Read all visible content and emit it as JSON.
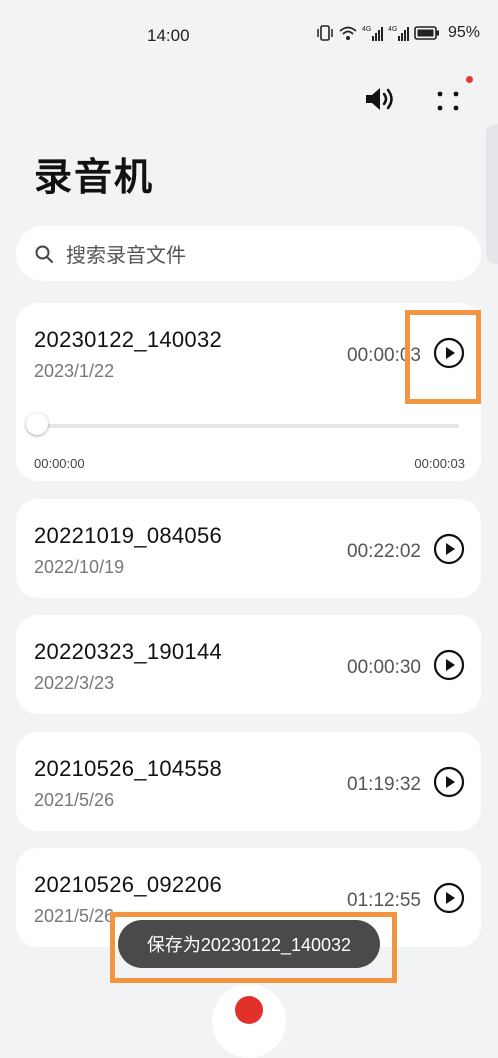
{
  "status_bar": {
    "time": "14:00",
    "battery": "95%"
  },
  "app": {
    "title": "录音机"
  },
  "search": {
    "placeholder": "搜索录音文件"
  },
  "recordings": [
    {
      "name": "20230122_140032",
      "date": "2023/1/22",
      "duration": "00:00:03",
      "expanded": true,
      "elapsed": "00:00:00",
      "total": "00:00:03",
      "progress": 0
    },
    {
      "name": "20221019_084056",
      "date": "2022/10/19",
      "duration": "00:22:02"
    },
    {
      "name": "20220323_190144",
      "date": "2022/3/23",
      "duration": "00:00:30"
    },
    {
      "name": "20210526_104558",
      "date": "2021/5/26",
      "duration": "01:19:32"
    },
    {
      "name": "20210526_092206",
      "date": "2021/5/26",
      "duration": "01:12:55"
    }
  ],
  "toast": {
    "message": "保存为20230122_140032"
  },
  "colors": {
    "accent_record": "#e0312b",
    "highlight": "#f39540",
    "badge": "#e53935"
  },
  "icons": {
    "speaker": "speaker-icon",
    "more": "more-dots-icon",
    "search": "search-icon",
    "play": "play-icon",
    "record": "record-icon"
  }
}
